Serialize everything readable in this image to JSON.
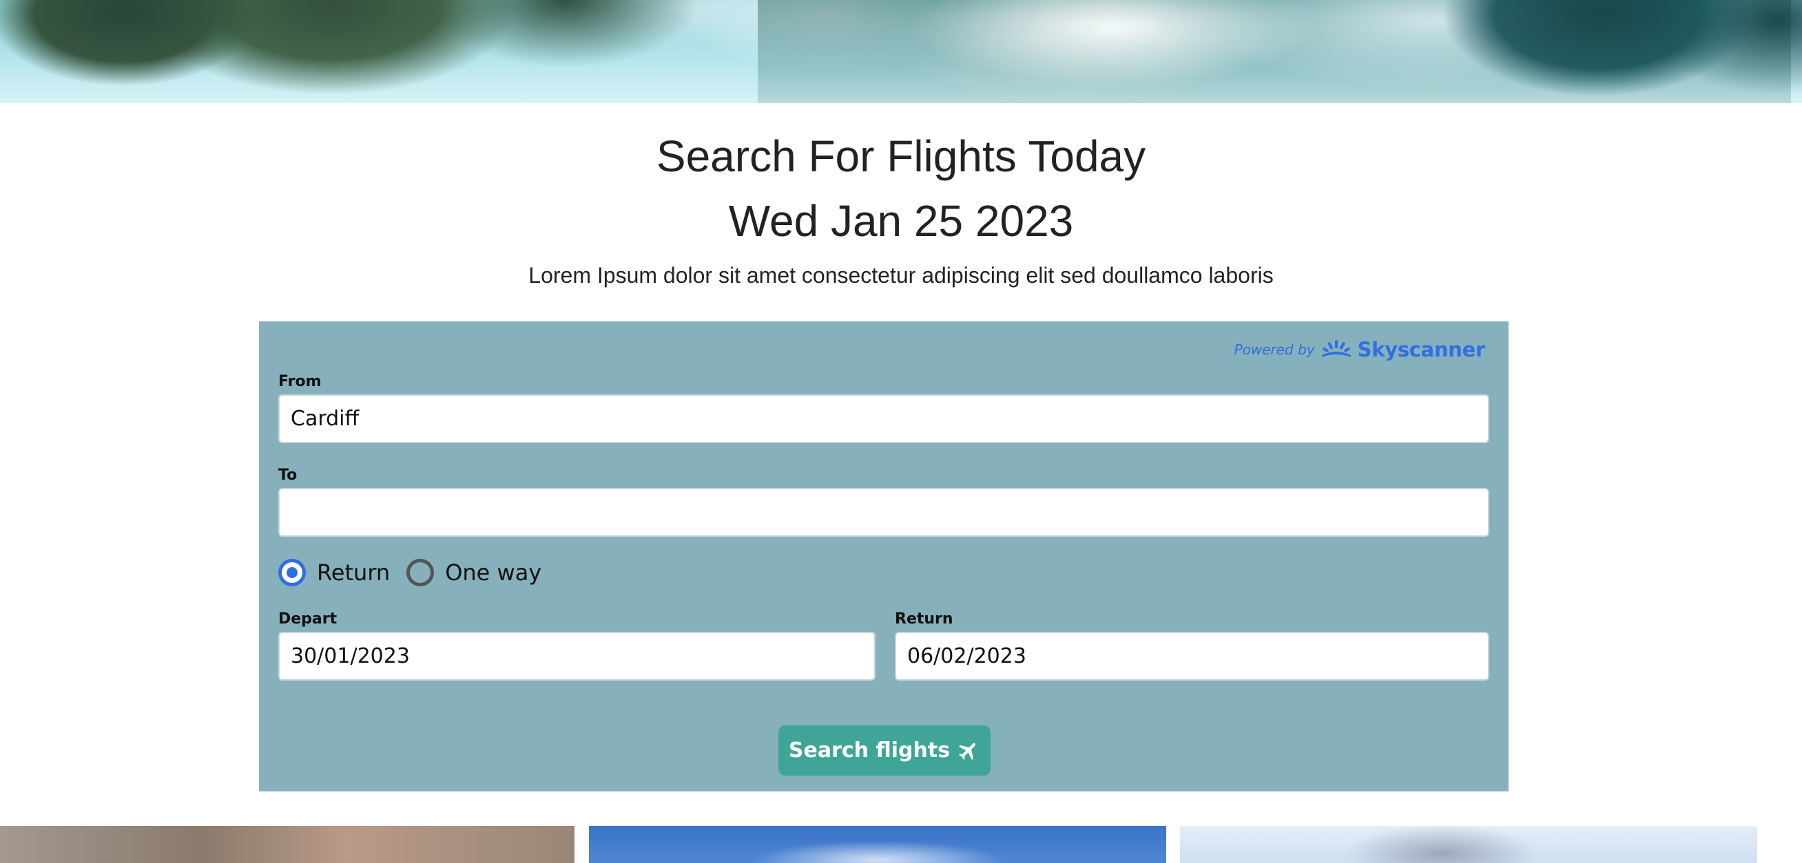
{
  "hero": {
    "alt": "mountain lake banner"
  },
  "heading": {
    "title": "Search For Flights Today",
    "date": "Wed Jan 25 2023",
    "subtitle": "Lorem Ipsum dolor sit amet consectetur adipiscing elit sed doullamco laboris"
  },
  "widget": {
    "powered_by": "Powered by",
    "brand": "Skyscanner",
    "brand_color": "#2f6fe2",
    "background_color": "#86b0bb",
    "from": {
      "label": "From",
      "value": "Cardiff"
    },
    "to": {
      "label": "To",
      "value": ""
    },
    "trip_type": {
      "options": [
        {
          "label": "Return",
          "selected": true
        },
        {
          "label": "One way",
          "selected": false
        }
      ]
    },
    "depart": {
      "label": "Depart",
      "value": "30/01/2023"
    },
    "return": {
      "label": "Return",
      "value": "06/02/2023"
    },
    "search_button": {
      "label": "Search flights",
      "icon": "plane-icon",
      "color": "#3fa697"
    }
  }
}
